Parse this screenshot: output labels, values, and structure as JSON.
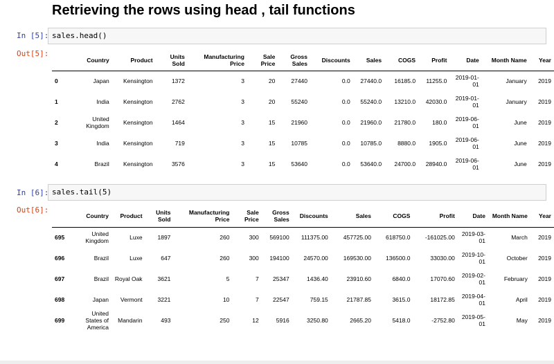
{
  "title": "Retrieving the rows using head , tail functions",
  "cell1": {
    "in_prompt": "In [5]:",
    "code": "sales.head()",
    "out_prompt": "Out[5]:",
    "columns": [
      "",
      "Country",
      "Product",
      "Units Sold",
      "Manufacturing Price",
      "Sale Price",
      "Gross Sales",
      "Discounts",
      "Sales",
      "COGS",
      "Profit",
      "Date",
      "Month Name",
      "Year"
    ],
    "rows": [
      [
        "0",
        "Japan",
        "Kensington",
        "1372",
        "3",
        "20",
        "27440",
        "0.0",
        "27440.0",
        "16185.0",
        "11255.0",
        "2019-01-01",
        "January",
        "2019"
      ],
      [
        "1",
        "India",
        "Kensington",
        "2762",
        "3",
        "20",
        "55240",
        "0.0",
        "55240.0",
        "13210.0",
        "42030.0",
        "2019-01-01",
        "January",
        "2019"
      ],
      [
        "2",
        "United Kingdom",
        "Kensington",
        "1464",
        "3",
        "15",
        "21960",
        "0.0",
        "21960.0",
        "21780.0",
        "180.0",
        "2019-06-01",
        "June",
        "2019"
      ],
      [
        "3",
        "India",
        "Kensington",
        "719",
        "3",
        "15",
        "10785",
        "0.0",
        "10785.0",
        "8880.0",
        "1905.0",
        "2019-06-01",
        "June",
        "2019"
      ],
      [
        "4",
        "Brazil",
        "Kensington",
        "3576",
        "3",
        "15",
        "53640",
        "0.0",
        "53640.0",
        "24700.0",
        "28940.0",
        "2019-06-01",
        "June",
        "2019"
      ]
    ]
  },
  "cell2": {
    "in_prompt": "In [6]:",
    "code": "sales.tail(5)",
    "out_prompt": "Out[6]:",
    "columns": [
      "",
      "Country",
      "Product",
      "Units Sold",
      "Manufacturing Price",
      "Sale Price",
      "Gross Sales",
      "Discounts",
      "Sales",
      "COGS",
      "Profit",
      "Date",
      "Month Name",
      "Year"
    ],
    "rows": [
      [
        "695",
        "United Kingdom",
        "Luxe",
        "1897",
        "260",
        "300",
        "569100",
        "111375.00",
        "457725.00",
        "618750.0",
        "-161025.00",
        "2019-03-01",
        "March",
        "2019"
      ],
      [
        "696",
        "Brazil",
        "Luxe",
        "647",
        "260",
        "300",
        "194100",
        "24570.00",
        "169530.00",
        "136500.0",
        "33030.00",
        "2019-10-01",
        "October",
        "2019"
      ],
      [
        "697",
        "Brazil",
        "Royal Oak",
        "3621",
        "5",
        "7",
        "25347",
        "1436.40",
        "23910.60",
        "6840.0",
        "17070.60",
        "2019-02-01",
        "February",
        "2019"
      ],
      [
        "698",
        "Japan",
        "Vermont",
        "3221",
        "10",
        "7",
        "22547",
        "759.15",
        "21787.85",
        "3615.0",
        "18172.85",
        "2019-04-01",
        "April",
        "2019"
      ],
      [
        "699",
        "United States of America",
        "Mandarin",
        "493",
        "250",
        "12",
        "5916",
        "3250.80",
        "2665.20",
        "5418.0",
        "-2752.80",
        "2019-05-01",
        "May",
        "2019"
      ]
    ]
  }
}
